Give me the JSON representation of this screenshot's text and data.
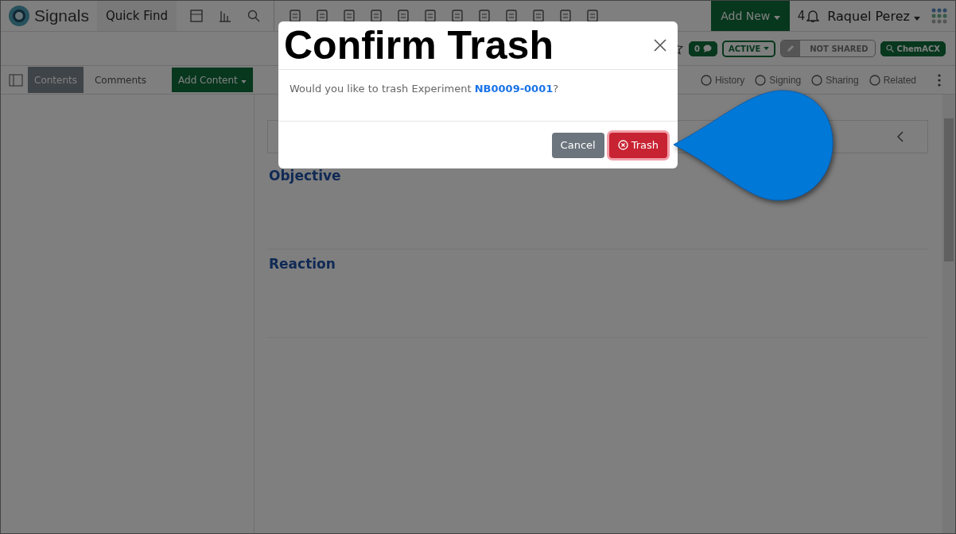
{
  "app": {
    "logo": "Signals",
    "quick_find": "Quick Find",
    "add_new": "Add New",
    "notification_count": "4",
    "user_name": "Raquel Perez"
  },
  "header_badges": {
    "comment_count": "0",
    "status": "ACTIVE",
    "sharing": "NOT SHARED",
    "search_button": "ChemACX"
  },
  "toolbar": {
    "tabs": [
      {
        "label": "Contents",
        "selected": true
      },
      {
        "label": "Comments",
        "selected": false
      }
    ],
    "add_content": "Add Content",
    "actions": [
      "History",
      "Signing",
      "Sharing",
      "Related"
    ]
  },
  "sections": [
    "Objective",
    "Reaction"
  ],
  "dialog": {
    "title": "Confirm Trash",
    "message": "Would you like to trash Experiment **NB0009-0001**?",
    "buttons": [
      {
        "label": "Cancel",
        "kind": "secondary"
      },
      {
        "label": "Trash",
        "kind": "danger"
      }
    ]
  }
}
